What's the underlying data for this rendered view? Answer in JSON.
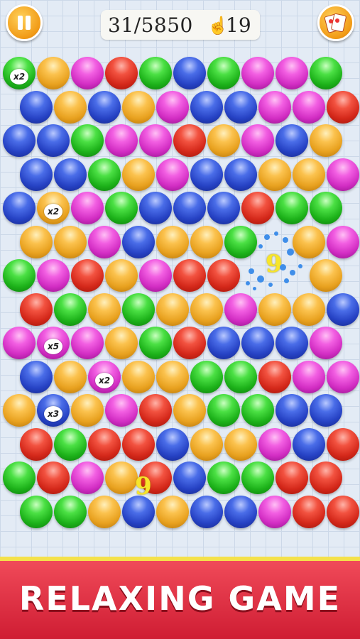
{
  "hud": {
    "score": "31/5850",
    "moves": "19",
    "pause_icon": "pause-icon",
    "moves_icon": "hand-pointer-icon",
    "cards_icon": "cards-icon"
  },
  "board": {
    "rows": [
      [
        "green",
        "yellow",
        "magenta",
        "red",
        "green",
        "blue",
        "green",
        "magenta",
        "magenta",
        "green"
      ],
      [
        "blue",
        "yellow",
        "blue",
        "yellow",
        "magenta",
        "blue",
        "blue",
        "magenta",
        "magenta",
        "red"
      ],
      [
        "blue",
        "blue",
        "green",
        "magenta",
        "magenta",
        "red",
        "yellow",
        "magenta",
        "blue",
        "yellow"
      ],
      [
        "blue",
        "blue",
        "green",
        "yellow",
        "magenta",
        "blue",
        "blue",
        "yellow",
        "yellow",
        "magenta"
      ],
      [
        "blue",
        "yellow",
        "magenta",
        "green",
        "blue",
        "blue",
        "blue",
        "red",
        "green",
        "green"
      ],
      [
        "yellow",
        "yellow",
        "magenta",
        "blue",
        "yellow",
        "yellow",
        "green",
        "",
        "yellow",
        "magenta"
      ],
      [
        "green",
        "magenta",
        "red",
        "yellow",
        "magenta",
        "red",
        "red",
        "",
        "",
        "yellow"
      ],
      [
        "red",
        "green",
        "yellow",
        "green",
        "yellow",
        "yellow",
        "magenta",
        "yellow",
        "yellow",
        "blue"
      ],
      [
        "magenta",
        "magenta",
        "magenta",
        "yellow",
        "green",
        "red",
        "blue",
        "blue",
        "blue",
        "magenta"
      ],
      [
        "blue",
        "yellow",
        "magenta",
        "yellow",
        "yellow",
        "green",
        "green",
        "red",
        "magenta",
        "magenta"
      ],
      [
        "yellow",
        "blue",
        "yellow",
        "magenta",
        "red",
        "yellow",
        "green",
        "green",
        "blue",
        "blue"
      ],
      [
        "red",
        "green",
        "red",
        "red",
        "blue",
        "yellow",
        "yellow",
        "magenta",
        "blue",
        "red"
      ],
      [
        "green",
        "red",
        "magenta",
        "yellow",
        "red",
        "blue",
        "green",
        "green",
        "red",
        "red"
      ],
      [
        "green",
        "green",
        "yellow",
        "blue",
        "yellow",
        "blue",
        "blue",
        "magenta",
        "red",
        "red"
      ]
    ],
    "multipliers": [
      {
        "row": 0,
        "col": 0,
        "label": "x2"
      },
      {
        "row": 4,
        "col": 1,
        "label": "x2"
      },
      {
        "row": 8,
        "col": 1,
        "label": "x5"
      },
      {
        "row": 9,
        "col": 2,
        "label": "x2"
      },
      {
        "row": 10,
        "col": 1,
        "label": "x3"
      }
    ],
    "floating_points": [
      "9",
      "9"
    ]
  },
  "banner": {
    "text": "RELAXING GAME"
  },
  "colors": {
    "banner": "#e0293e",
    "banner_border": "#f4e14a",
    "button_orange": "#f19a16",
    "points_yellow": "#f7e52a"
  }
}
